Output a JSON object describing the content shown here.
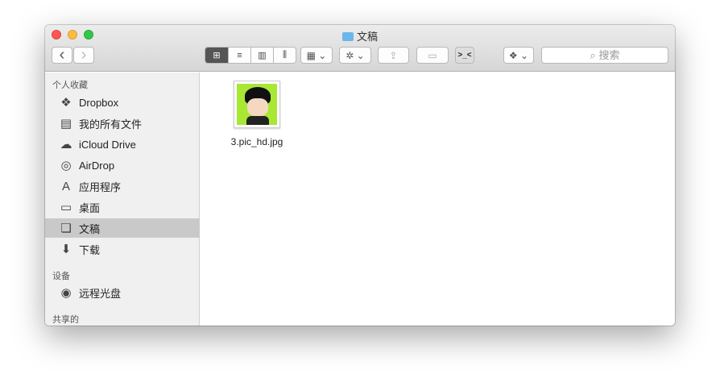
{
  "window": {
    "title": "文稿"
  },
  "toolbar": {
    "back": "‹",
    "forward": "›",
    "views": [
      "⊞",
      "≡",
      "▥",
      "⫼"
    ],
    "arrange": "▦ ⌄",
    "action": "✲ ⌄",
    "share": "⇪",
    "tag": "▭",
    "custom": ">_<",
    "dropbox": "❖ ⌄",
    "search_placeholder": "搜索",
    "search_icon": "⌕"
  },
  "sidebar": {
    "favorites_header": "个人收藏",
    "favorites": [
      {
        "label": "Dropbox",
        "icon": "❖"
      },
      {
        "label": "我的所有文件",
        "icon": "▤"
      },
      {
        "label": "iCloud Drive",
        "icon": "☁"
      },
      {
        "label": "AirDrop",
        "icon": "◎"
      },
      {
        "label": "应用程序",
        "icon": "A"
      },
      {
        "label": "桌面",
        "icon": "▭"
      },
      {
        "label": "文稿",
        "icon": "❏"
      },
      {
        "label": "下载",
        "icon": "⬇"
      }
    ],
    "devices_header": "设备",
    "devices": [
      {
        "label": "远程光盘",
        "icon": "◉"
      }
    ],
    "shared_header": "共享的"
  },
  "files": [
    {
      "name": "3.pic_hd.jpg"
    }
  ]
}
